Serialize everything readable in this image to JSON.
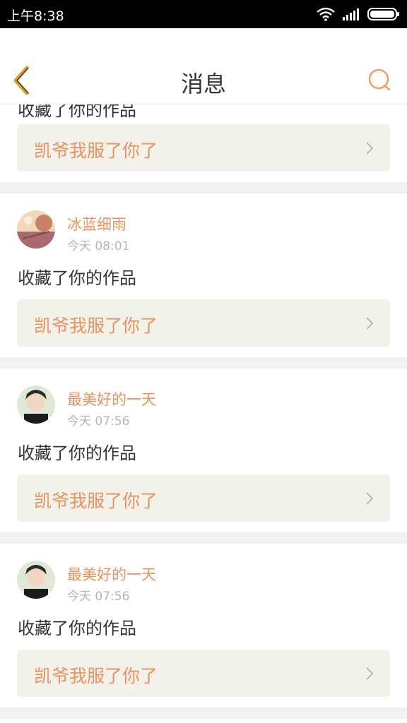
{
  "status_bar": {
    "time": "上午8:38"
  },
  "header": {
    "title": "消息"
  },
  "partial_card": {
    "action": "收藏了你的作品",
    "work_title": "凯爷我服了你了"
  },
  "messages": [
    {
      "user": "冰蓝细雨",
      "time": "今天 08:01",
      "action": "收藏了你的作品",
      "work_title": "凯爷我服了你了"
    },
    {
      "user": "最美好的一天",
      "time": "今天 07:56",
      "action": "收藏了你的作品",
      "work_title": "凯爷我服了你了"
    },
    {
      "user": "最美好的一天",
      "time": "今天 07:56",
      "action": "收藏了你的作品",
      "work_title": "凯爷我服了你了"
    }
  ],
  "colors": {
    "accent": "#e8935f",
    "back_icon": "#d8a520",
    "link_bg": "#f3f2ea"
  },
  "icons": {
    "back": "chevron-left-icon",
    "chat": "chat-bubble-icon",
    "chevron": "chevron-right-icon"
  }
}
